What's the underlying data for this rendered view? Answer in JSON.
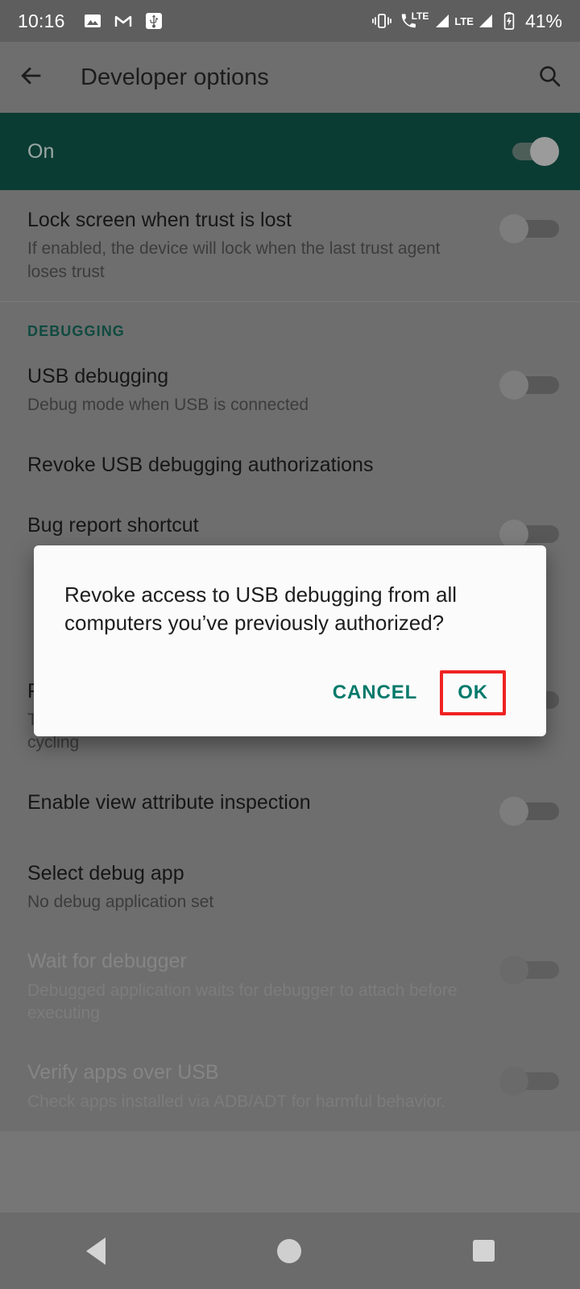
{
  "statusbar": {
    "time": "10:16",
    "left_icons": [
      "photos-icon",
      "gmail-icon",
      "usb-icon"
    ],
    "right_icons": [
      "vibrate-icon",
      "call-lte-icon",
      "signal-bars-icon",
      "lte-label-icon",
      "signal-bars-2-icon",
      "battery-charging-icon"
    ],
    "lte_label_1": "LTE",
    "lte_label_2": "LTE",
    "battery_percent": "41%"
  },
  "appbar": {
    "back_icon": "back-arrow-icon",
    "title": "Developer options",
    "search_icon": "search-icon"
  },
  "master_switch": {
    "label": "On",
    "state": "on"
  },
  "sections": [
    {
      "header": null,
      "items": [
        {
          "title": "Lock screen when trust is lost",
          "subtitle": "If enabled, the device will lock when the last trust agent loses trust",
          "toggle": "off",
          "disabled": false
        }
      ]
    },
    {
      "header": "DEBUGGING",
      "items": [
        {
          "title": "USB debugging",
          "subtitle": "Debug mode when USB is connected",
          "toggle": "off",
          "disabled": false
        },
        {
          "title": "Revoke USB debugging authorizations",
          "subtitle": null,
          "toggle": null,
          "disabled": false
        },
        {
          "title": "Bug report shortcut",
          "subtitle": null,
          "toggle": null,
          "disabled": false
        },
        {
          "title": "Force full GNSS measurements",
          "subtitle": "Track all GNSS constellations and frequencies with no duty cycling",
          "toggle": "off",
          "disabled": false
        },
        {
          "title": "Enable view attribute inspection",
          "subtitle": null,
          "toggle": "off",
          "disabled": false
        },
        {
          "title": "Select debug app",
          "subtitle": "No debug application set",
          "toggle": null,
          "disabled": false
        },
        {
          "title": "Wait for debugger",
          "subtitle": "Debugged application waits for debugger to attach before executing",
          "toggle": "off",
          "disabled": true
        },
        {
          "title": "Verify apps over USB",
          "subtitle": "Check apps installed via ADB/ADT for harmful behavior.",
          "toggle": "off",
          "disabled": true
        }
      ]
    }
  ],
  "dialog": {
    "message": "Revoke access to USB debugging from all computers you’ve previously authorized?",
    "cancel_label": "CANCEL",
    "ok_label": "OK",
    "highlighted_button": "OK",
    "highlight_color": "#ef2222",
    "accent_color": "#00796b"
  },
  "navbar": {
    "back": "nav-back-icon",
    "home": "nav-home-icon",
    "recents": "nav-recents-icon"
  }
}
